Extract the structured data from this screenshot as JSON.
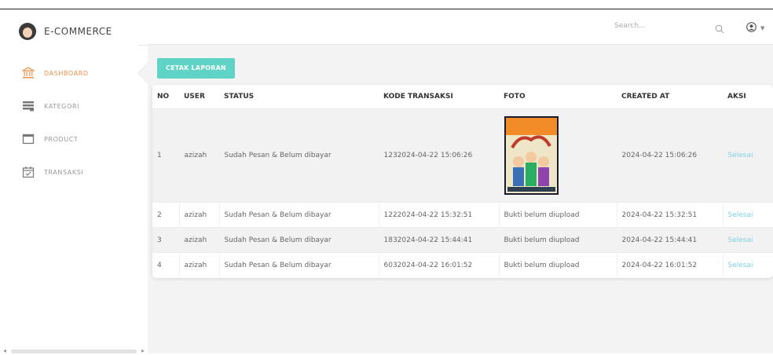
{
  "sidebar": {
    "brand": "E-COMMERCE",
    "items": [
      {
        "label": "DASHBOARD",
        "icon": "bank-icon",
        "active": true
      },
      {
        "label": "KATEGORI",
        "icon": "list-icon",
        "active": false
      },
      {
        "label": "PRODUCT",
        "icon": "window-icon",
        "active": false
      },
      {
        "label": "TRANSAKSI",
        "icon": "calendar-check-icon",
        "active": false
      }
    ]
  },
  "topbar": {
    "search_placeholder": "Search..."
  },
  "main": {
    "print_button": "CETAK LAPORAN",
    "table": {
      "headers": [
        "NO",
        "USER",
        "STATUS",
        "KODE TRANSAKSI",
        "FOTO",
        "CREATED AT",
        "AKSI"
      ],
      "rows": [
        {
          "no": "1",
          "user": "azizah",
          "status": "Sudah Pesan & Belum dibayar",
          "kode": "1232024-04-22 15:06:26",
          "foto": "",
          "created_at": "2024-04-22 15:06:26",
          "aksi": "Selesai"
        },
        {
          "no": "2",
          "user": "azizah",
          "status": "Sudah Pesan & Belum dibayar",
          "kode": "1222024-04-22 15:32:51",
          "foto": "Bukti belum diupload",
          "created_at": "2024-04-22 15:32:51",
          "aksi": "Selesai"
        },
        {
          "no": "3",
          "user": "azizah",
          "status": "Sudah Pesan & Belum dibayar",
          "kode": "1832024-04-22 15:44:41",
          "foto": "Bukti belum diupload",
          "created_at": "2024-04-22 15:44:41",
          "aksi": "Selesai"
        },
        {
          "no": "4",
          "user": "azizah",
          "status": "Sudah Pesan & Belum dibayar",
          "kode": "6032024-04-22 16:01:52",
          "foto": "Bukti belum diupload",
          "created_at": "2024-04-22 16:01:52",
          "aksi": "Selesai"
        }
      ]
    }
  },
  "colors": {
    "accent_orange": "#f0914a",
    "button_teal": "#5fd3c6",
    "link_blue": "#7fd1e4"
  }
}
